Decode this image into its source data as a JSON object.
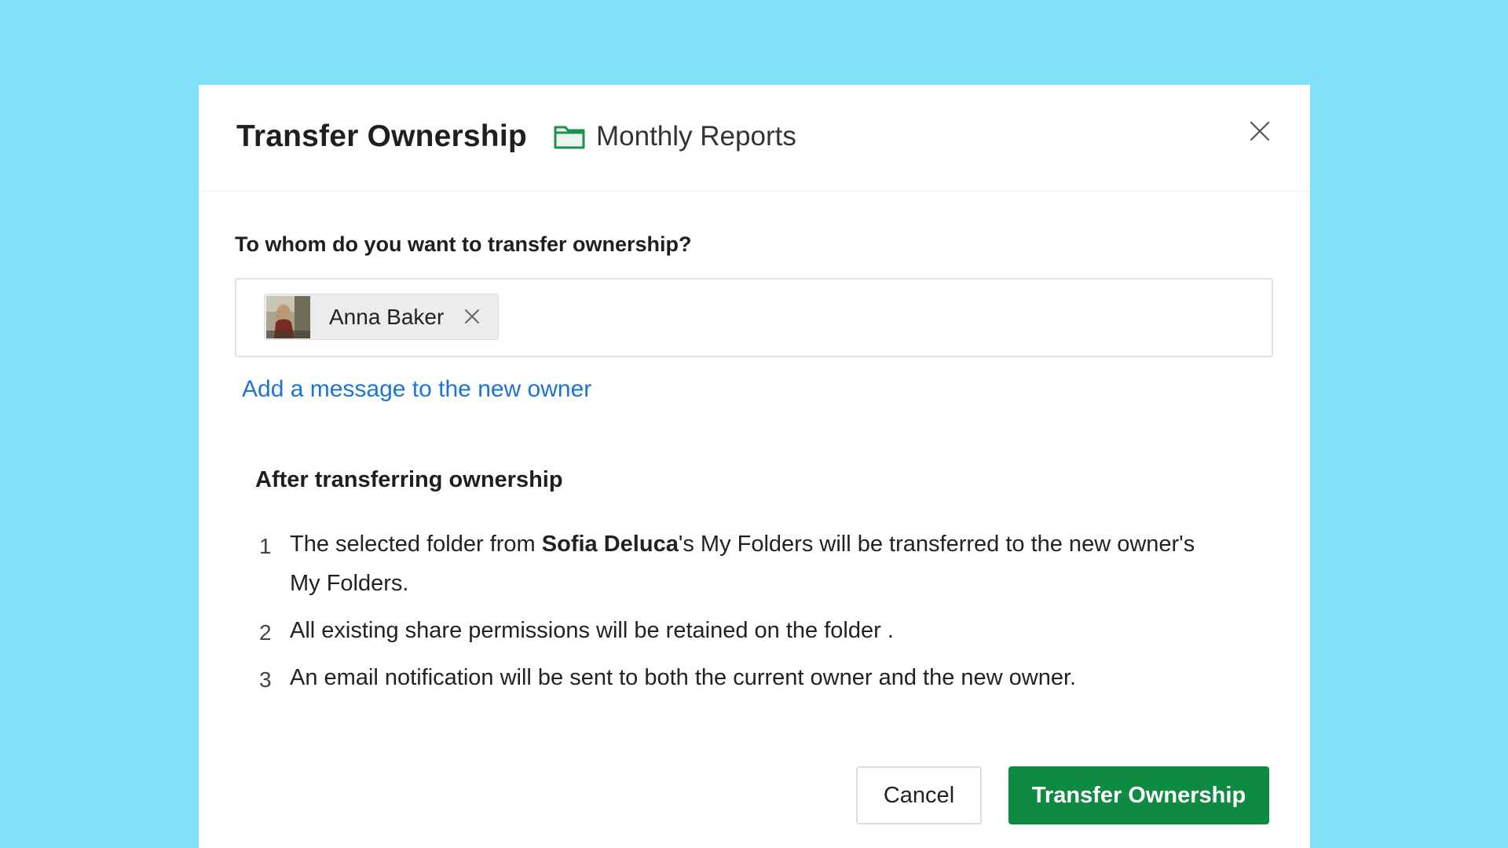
{
  "dialog": {
    "title": "Transfer Ownership",
    "folder_icon": "folder-icon",
    "folder_name": "Monthly Reports",
    "close_icon": "close-icon"
  },
  "recipient": {
    "question": "To whom do you want to transfer ownership?",
    "chips": [
      {
        "name": "Anna Baker",
        "avatar": "user-avatar",
        "remove_icon": "close-icon"
      }
    ]
  },
  "add_message_link": "Add a message to the new owner",
  "after": {
    "heading": "After transferring ownership",
    "steps": [
      {
        "number": "1",
        "text_before": "The selected folder from ",
        "bold": "Sofia Deluca",
        "text_after": "'s My Folders will be transferred to the new owner's My Folders."
      },
      {
        "number": "2",
        "text": "All existing share permissions will be retained on the folder ."
      },
      {
        "number": "3",
        "text": "An email notification will be sent to both the current owner and the new owner."
      }
    ]
  },
  "buttons": {
    "cancel": "Cancel",
    "transfer": "Transfer Ownership"
  },
  "colors": {
    "background": "#82dff8",
    "primary_button": "#0f8a43",
    "link": "#1b74d6",
    "folder_icon": "#1f8f4e"
  }
}
